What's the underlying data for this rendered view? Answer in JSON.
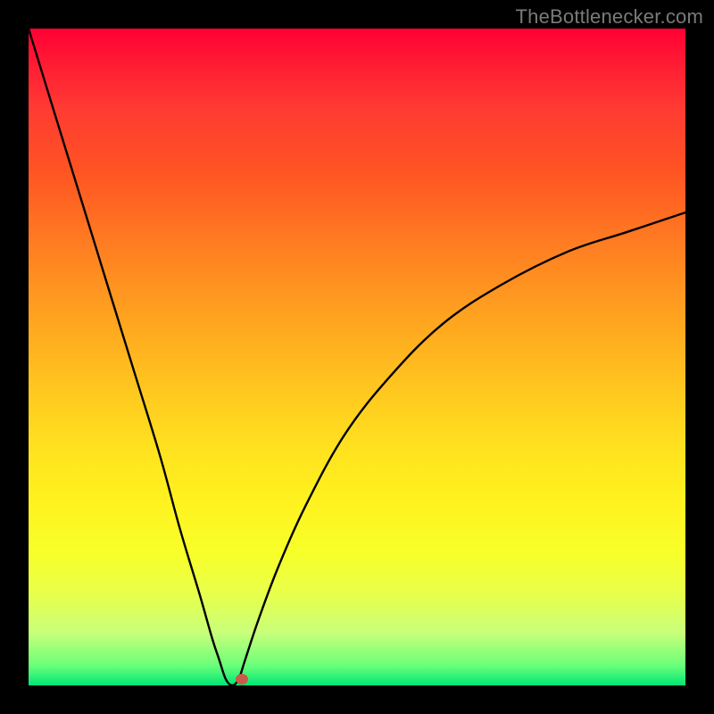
{
  "attribution": "TheBottlenecker.com",
  "colors": {
    "frame": "#000000",
    "gradient_top": "#ff0033",
    "gradient_bottom": "#00e676",
    "curve": "#000000",
    "marker": "#cc5a4a",
    "attribution_text": "#7a7a7a"
  },
  "chart_data": {
    "type": "line",
    "title": "",
    "xlabel": "",
    "ylabel": "",
    "xlim": [
      0,
      100
    ],
    "ylim": [
      0,
      100
    ],
    "note": "Bottleneck-style V curve. y=0 at the optimal x (~31), rising steeply on both sides; left branch reaches ~100 near x=0, right branch asymptotes toward ~72 at x=100.",
    "minimum": {
      "x": 31,
      "y": 0
    },
    "series": [
      {
        "name": "bottleneck-curve",
        "x": [
          0,
          4,
          8,
          12,
          16,
          20,
          23,
          26,
          28,
          29,
          30,
          31,
          32,
          33,
          35,
          38,
          42,
          48,
          55,
          63,
          72,
          82,
          91,
          100
        ],
        "y": [
          100,
          87,
          74,
          61,
          48,
          35,
          24,
          14,
          7,
          4,
          1,
          0,
          1,
          4,
          10,
          18,
          27,
          38,
          47,
          55,
          61,
          66,
          69,
          72
        ]
      }
    ],
    "marker_point": {
      "x": 32.5,
      "y": 1
    }
  }
}
